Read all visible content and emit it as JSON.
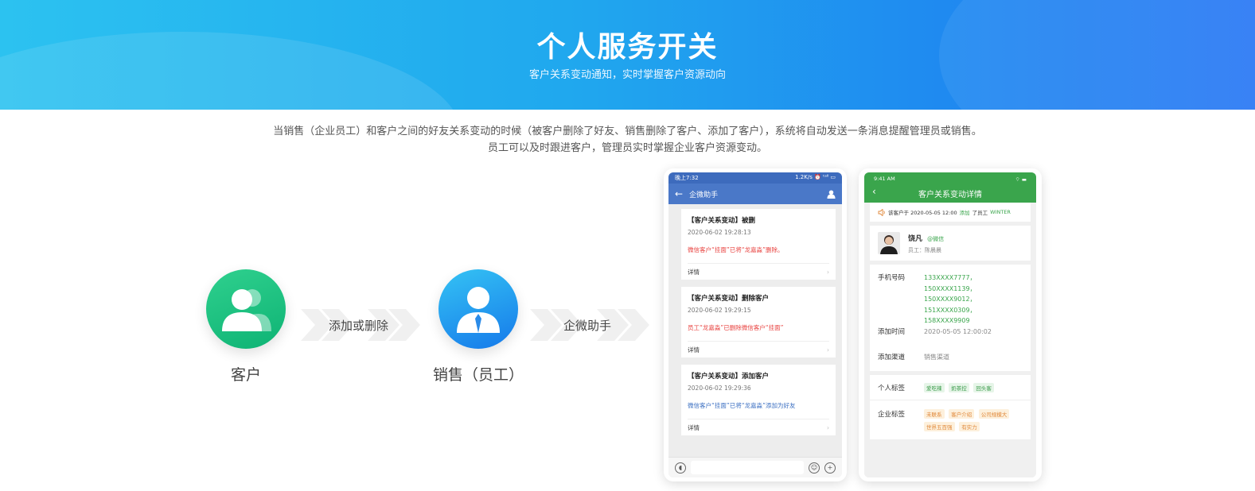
{
  "banner": {
    "title": "个人服务开关",
    "subtitle": "客户关系变动通知，实时掌握客户资源动向"
  },
  "description": {
    "line1": "当销售（企业员工）和客户之间的好友关系变动的时候（被客户删除了好友、销售删除了客户、添加了客户），系统将自动发送一条消息提醒管理员或销售。",
    "line2": "员工可以及时跟进客户，管理员实时掌握企业客户资源变动。"
  },
  "flow": {
    "customer_label": "客户",
    "action_label": "添加或删除",
    "sales_label": "销售（员工）",
    "assistant_label": "企微助手"
  },
  "phone1": {
    "status_time": "晚上7:32",
    "status_right": "1.2K/s ⏰ ᵗᵃˡˡ ▭",
    "header_title": "企微助手",
    "detail_label": "详情",
    "messages": [
      {
        "title": "【客户关系变动】被删",
        "time": "2020-06-02 19:28:13",
        "text": "微信客户“挂面”已将“龙嘉淼”删除。"
      },
      {
        "title": "【客户关系变动】删除客户",
        "time": "2020-06-02 19:29:15",
        "text": "员工“龙嘉淼”已删除微信客户“挂面”"
      },
      {
        "title": "【客户关系变动】添加客户",
        "time": "2020-06-02 19:29:36",
        "text": "微信客户“挂面”已将“龙嘉淼”添加为好友"
      }
    ]
  },
  "phone2": {
    "status_time": "9:41 AM",
    "header_title": "客户关系变动详情",
    "notice_prefix": "该客户于 2020-05-05 12:00",
    "notice_action": "添加",
    "notice_mid": "了员工",
    "notice_staff": "WINTER",
    "customer_name": "饶凡",
    "customer_source": "@微信",
    "staff_line": "员工：陈晨晨",
    "phone_label": "手机号码",
    "phones": [
      "133XXXX7777，150XXXX1139，",
      "150XXXX9012，151XXXX0309，",
      "158XXXX9909"
    ],
    "add_time_label": "添加时间",
    "add_time": "2020-05-05 12:00:02",
    "channel_label": "添加渠道",
    "channel": "销售渠道",
    "personal_tags_label": "个人标签",
    "personal_tags": [
      "爱吃辣",
      "奶茶控",
      "回头客"
    ],
    "company_tags_label": "企业标签",
    "company_tags": [
      "未联系",
      "客户介绍",
      "公司规模大",
      "世界五百强",
      "有实力"
    ]
  },
  "colors": {
    "banner_start": "#2cc2f0",
    "banner_end": "#2a79f5",
    "customer_circle": "#13bf7d",
    "sales_circle": "#1a8ef0",
    "phone1_header": "#4a78c8",
    "phone2_header": "#3aa54c",
    "alert_red": "#e8423f",
    "link_blue": "#3b6fc2",
    "green_text": "#3aa54c"
  }
}
